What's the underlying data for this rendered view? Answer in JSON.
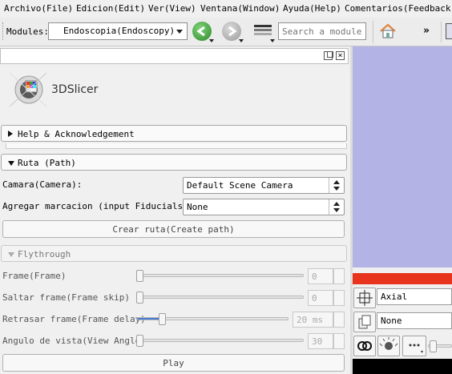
{
  "menu": [
    "Archivo(File)",
    "Edicion(Edit)",
    "Ver(View)",
    "Ventana(Window)",
    "Ayuda(Help)",
    "Comentarios(Feedback)"
  ],
  "toolbar": {
    "modules_label": "Modules:",
    "module_selected": "Endoscopia(Endoscopy)",
    "search_placeholder": "Search a module",
    "more_glyph": "»"
  },
  "logo": {
    "text": "3DSlicer"
  },
  "sections": {
    "help": "Help & Acknowledgement",
    "path": "Ruta (Path)",
    "flythrough": "Flythrough"
  },
  "path": {
    "camera_label": "Camara(Camera):",
    "camera_value": "Default Scene Camera",
    "fiducials_label": "Agregar marcacion (input Fiducials:):",
    "fiducials_value": "None",
    "create_button": "Crear ruta(Create path)"
  },
  "flythrough": {
    "frame_label": "Frame(Frame)",
    "frame_value": "0",
    "skip_label": "Saltar frame(Frame skip)",
    "skip_value": "0",
    "delay_label": "Retrasar frame(Frame delay)",
    "delay_value": "20 ms",
    "angle_label": "Angulo de vista(View Angle)",
    "angle_value": "30",
    "play_button": "Play"
  },
  "slice": {
    "orientation": "Axial",
    "volume": "None"
  },
  "colors": {
    "view_background": "#b3b3e6",
    "slice_bar": "#e8341c"
  }
}
